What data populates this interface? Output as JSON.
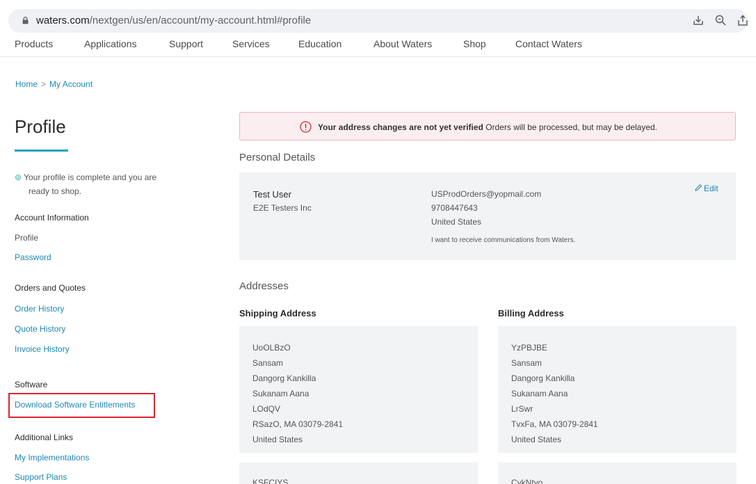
{
  "browser": {
    "url_host": "waters.com",
    "url_path": "/nextgen/us/en/account/my-account.html#profile"
  },
  "nav": {
    "items": [
      "Products",
      "Applications",
      "Support",
      "Services",
      "Education",
      "About Waters",
      "Shop",
      "Contact Waters"
    ]
  },
  "breadcrumb": {
    "home": "Home",
    "separator": ">",
    "current": "My Account"
  },
  "sidebar": {
    "title": "Profile",
    "status_line1": "Your profile is complete and you are",
    "status_line2": "ready to shop.",
    "account_info_heading": "Account Information",
    "profile_link": "Profile",
    "password_link": "Password",
    "orders_heading": "Orders and Quotes",
    "order_history": "Order History",
    "quote_history": "Quote History",
    "invoice_history": "Invoice History",
    "software_heading": "Software",
    "download_software": "Download Software Entitlements",
    "additional_heading": "Additional Links",
    "my_implementations": "My Implementations",
    "support_plans": "Support Plans"
  },
  "alert": {
    "bold": "Your address changes are not yet verified",
    "rest": "Orders will be processed, but may be delayed."
  },
  "personal": {
    "heading": "Personal Details",
    "name": "Test User",
    "company": "E2E Testers Inc",
    "email": "USProdOrders@yopmail.com",
    "phone": "9708447643",
    "country": "United States",
    "communications": "I want to receive communications from Waters.",
    "edit_label": "Edit"
  },
  "addresses": {
    "heading": "Addresses",
    "shipping_heading": "Shipping Address",
    "billing_heading": "Billing Address",
    "shipping": [
      "UoOLBzO",
      "Sansam",
      "Dangorg Kankilla",
      "Sukanam Aana",
      "LOdQV",
      "RSazO, MA 03079-2841",
      "United States"
    ],
    "billing": [
      "YzPBJBE",
      "Sansam",
      "Dangorg Kankilla",
      "Sukanam Aana",
      "LrSwr",
      "TvxFa, MA 03079-2841",
      "United States"
    ],
    "shipping_next_partial": "KSFCIYS",
    "billing_next_partial": "CykNtyo"
  },
  "colors": {
    "accent": "#1aa5c2",
    "link": "#1e88b4",
    "alert_bg": "#fbeef0",
    "alert_border": "#f1b4bd",
    "alert_icon": "#d9252e",
    "highlight_box": "#d9252e",
    "card_bg": "#f1f3f5"
  },
  "icons": [
    "lock-icon",
    "download-icon",
    "zoom-icon",
    "share-icon",
    "check-circle-icon",
    "warning-icon",
    "pencil-icon"
  ]
}
